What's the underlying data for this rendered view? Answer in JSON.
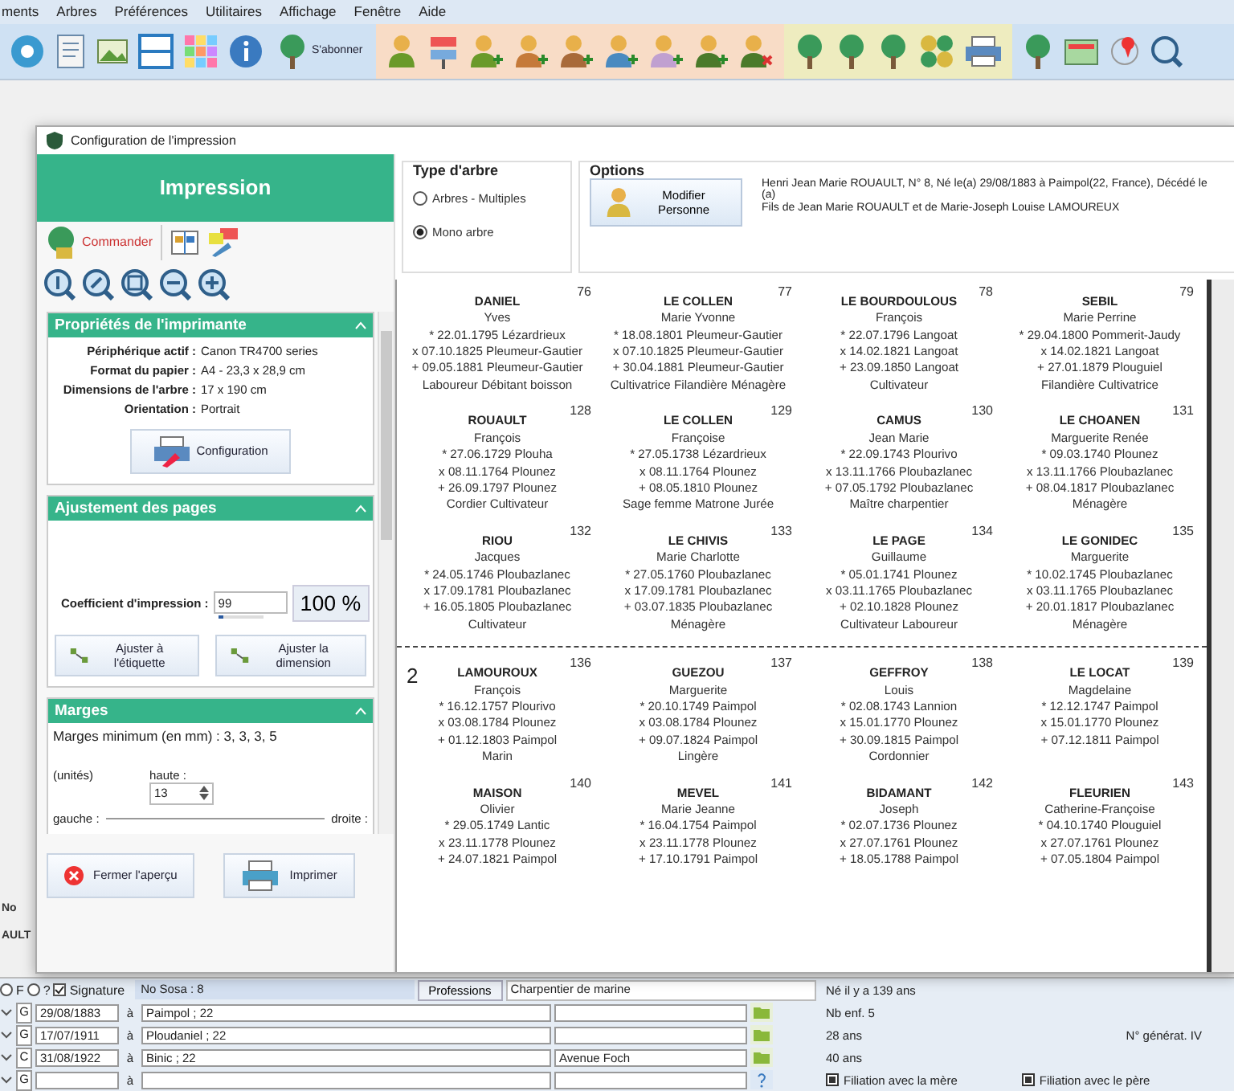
{
  "menu": [
    "ments",
    "Arbres",
    "Préférences",
    "Utilitaires",
    "Affichage",
    "Fenêtre",
    "Aide"
  ],
  "toolbar": {
    "subscribe_label": "S'abonner"
  },
  "background_labels": [
    "No",
    "AULT"
  ],
  "dialog": {
    "title": "Configuration de l'impression",
    "panel": {
      "header": "Impression",
      "commander": "Commander",
      "printer_section": {
        "title": "Propriétés de l'imprimante",
        "fields": [
          {
            "label": "Périphérique actif :",
            "value": "Canon TR4700 series"
          },
          {
            "label": "Format du papier :",
            "value": "A4 - 23,3 x 28,9 cm"
          },
          {
            "label": "Dimensions de l'arbre :",
            "value": "17 x 190 cm"
          },
          {
            "label": "Orientation :",
            "value": "Portrait"
          }
        ],
        "button": "Configuration"
      },
      "adjust_section": {
        "title": "Ajustement des pages",
        "coef_label": "Coefficient d'impression :",
        "coef_value": "99",
        "coef_slider": {
          "level": 0.1
        },
        "percent_button": "100 %",
        "buttons": [
          "Ajuster à l'étiquette",
          "Ajuster la dimension"
        ]
      },
      "margin_section": {
        "title": "Marges",
        "minimum": "Marges minimum (en mm) : 3, 3, 3, 5",
        "unit": "(unités)",
        "top_label": "haute :",
        "top_value": "13",
        "left_label": "gauche :",
        "right_label": "droite :"
      },
      "close_button": "Fermer l'aperçu",
      "print_button": "Imprimer"
    },
    "tree_type": {
      "title": "Type d'arbre",
      "options": [
        {
          "label": "Arbres - Multiples",
          "selected": false
        },
        {
          "label": "Mono arbre",
          "selected": true
        }
      ]
    },
    "options": {
      "title": "Options",
      "button": "Modifier Personne",
      "info": [
        "Henri Jean Marie ROUAULT, N° 8, Né le(a) 29/08/1883 à Paimpol(22, France), Décédé le (a)",
        "Fils de Jean Marie ROUAULT et de Marie-Joseph Louise LAMOUREUX"
      ]
    },
    "tree": {
      "pages": [
        {
          "cards": [
            {
              "number": "76",
              "surname": "DANIEL",
              "given": "Yves",
              "lines": [
                "* 22.01.1795  Lézardrieux",
                "x 07.10.1825  Pleumeur-Gautier",
                "+ 09.05.1881  Pleumeur-Gautier",
                "Laboureur Débitant boisson"
              ]
            },
            {
              "number": "77",
              "surname": "LE COLLEN",
              "given": "Marie Yvonne",
              "lines": [
                "* 18.08.1801  Pleumeur-Gautier",
                "x 07.10.1825  Pleumeur-Gautier",
                "+ 30.04.1881  Pleumeur-Gautier",
                "Cultivatrice Filandière Ménagère"
              ]
            },
            {
              "number": "78",
              "surname": "LE BOURDOULOUS",
              "given": "François",
              "lines": [
                "* 22.07.1796  Langoat",
                "x 14.02.1821  Langoat",
                "+ 23.09.1850  Langoat",
                "Cultivateur"
              ]
            },
            {
              "number": "79",
              "surname": "SEBIL",
              "given": "Marie Perrine",
              "lines": [
                "* 29.04.1800  Pommerit-Jaudy",
                "x 14.02.1821  Langoat",
                "+ 27.01.1879  Plouguiel",
                "Filandière Cultivatrice"
              ]
            },
            {
              "number": "128",
              "surname": "ROUAULT",
              "given": "François",
              "lines": [
                "* 27.06.1729  Plouha",
                "x 08.11.1764  Plounez",
                "+ 26.09.1797  Plounez",
                "Cordier Cultivateur"
              ]
            },
            {
              "number": "129",
              "surname": "LE COLLEN",
              "given": "Françoise",
              "lines": [
                "* 27.05.1738  Lézardrieux",
                "x 08.11.1764  Plounez",
                "+ 08.05.1810  Plounez",
                "Sage femme Matrone Jurée"
              ]
            },
            {
              "number": "130",
              "surname": "CAMUS",
              "given": "Jean Marie",
              "lines": [
                "* 22.09.1743  Plourivo",
                "x 13.11.1766  Ploubazlanec",
                "+ 07.05.1792  Ploubazlanec",
                "Maître charpentier"
              ]
            },
            {
              "number": "131",
              "surname": "LE CHOANEN",
              "given": "Marguerite Renée",
              "lines": [
                "* 09.03.1740  Plounez",
                "x 13.11.1766  Ploubazlanec",
                "+ 08.04.1817  Ploubazlanec",
                "Ménagère"
              ]
            },
            {
              "number": "132",
              "surname": "RIOU",
              "given": "Jacques",
              "lines": [
                "* 24.05.1746  Ploubazlanec",
                "x 17.09.1781  Ploubazlanec",
                "+ 16.05.1805  Ploubazlanec",
                "Cultivateur"
              ]
            },
            {
              "number": "133",
              "surname": "LE CHIVIS",
              "given": "Marie Charlotte",
              "lines": [
                "* 27.05.1760  Ploubazlanec",
                "x 17.09.1781  Ploubazlanec",
                "+ 03.07.1835  Ploubazlanec",
                "Ménagère"
              ]
            },
            {
              "number": "134",
              "surname": "LE PAGE",
              "given": "Guillaume",
              "lines": [
                "* 05.01.1741  Plounez",
                "x 03.11.1765  Ploubazlanec",
                "+ 02.10.1828  Plounez",
                "Cultivateur Laboureur"
              ]
            },
            {
              "number": "135",
              "surname": "LE GONIDEC",
              "given": "Marguerite",
              "lines": [
                "* 10.02.1745  Ploubazlanec",
                "x 03.11.1765  Ploubazlanec",
                "+ 20.01.1817  Ploubazlanec",
                "Ménagère"
              ]
            }
          ]
        },
        {
          "page_number": "2",
          "cards": [
            {
              "number": "136",
              "surname": "LAMOUROUX",
              "given": "François",
              "lines": [
                "* 16.12.1757  Plourivo",
                "x 03.08.1784  Plounez",
                "+ 01.12.1803  Paimpol",
                "Marin"
              ]
            },
            {
              "number": "137",
              "surname": "GUEZOU",
              "given": "Marguerite",
              "lines": [
                "* 20.10.1749  Paimpol",
                "x 03.08.1784  Plounez",
                "+ 09.07.1824  Paimpol",
                "Lingère"
              ]
            },
            {
              "number": "138",
              "surname": "GEFFROY",
              "given": "Louis",
              "lines": [
                "* 02.08.1743  Lannion",
                "x 15.01.1770  Plounez",
                "+ 30.09.1815  Paimpol",
                "Cordonnier"
              ]
            },
            {
              "number": "139",
              "surname": "LE LOCAT",
              "given": "Magdelaine",
              "lines": [
                "* 12.12.1747  Paimpol",
                "x 15.01.1770  Plounez",
                "+ 07.12.1811  Paimpol"
              ]
            },
            {
              "number": "140",
              "surname": "MAISON",
              "given": "Olivier",
              "lines": [
                "* 29.05.1749  Lantic",
                "x 23.11.1778  Plounez",
                "+ 24.07.1821  Paimpol"
              ]
            },
            {
              "number": "141",
              "surname": "MEVEL",
              "given": "Marie Jeanne",
              "lines": [
                "* 16.04.1754  Paimpol",
                "x 23.11.1778  Plounez",
                "+ 17.10.1791  Paimpol"
              ]
            },
            {
              "number": "142",
              "surname": "BIDAMANT",
              "given": "Joseph",
              "lines": [
                "* 02.07.1736  Plounez",
                "x 27.07.1761  Plounez",
                "+ 18.05.1788  Paimpol"
              ]
            },
            {
              "number": "143",
              "surname": "FLEURIEN",
              "given": "Catherine-Françoise",
              "lines": [
                "* 04.10.1740  Plouguiel",
                "x 27.07.1761  Plounez",
                "+ 07.05.1804  Paimpol"
              ]
            }
          ]
        }
      ]
    }
  },
  "person_form": {
    "radios": [
      {
        "label": "F",
        "selected": false
      },
      {
        "label": "?",
        "selected": false
      }
    ],
    "signature": {
      "label": "Signature",
      "checked": true
    },
    "sosa": "No Sosa : 8",
    "professions_button": "Professions",
    "profession": "Charpentier de marine",
    "age_note": "Né il y a 139 ans",
    "events": [
      {
        "type": "G",
        "date": "29/08/1883",
        "at": "à",
        "place": "Paimpol ; 22",
        "info": "Nb enf. 5"
      },
      {
        "type": "G",
        "date": "17/07/1911",
        "at": "à",
        "place": "Ploudaniel ; 22",
        "info": "28 ans"
      },
      {
        "type": "C",
        "date": "31/08/1922",
        "at": "à",
        "place": "Binic ; 22",
        "address": "Avenue Foch",
        "info": "40 ans"
      },
      {
        "type": "G",
        "at": "à",
        "unknown": true
      }
    ],
    "generation": "N° générat. IV",
    "filiations": [
      {
        "label": "Filiation avec la mère",
        "checked": true
      },
      {
        "label": "Filiation avec le père",
        "checked": true
      }
    ]
  }
}
